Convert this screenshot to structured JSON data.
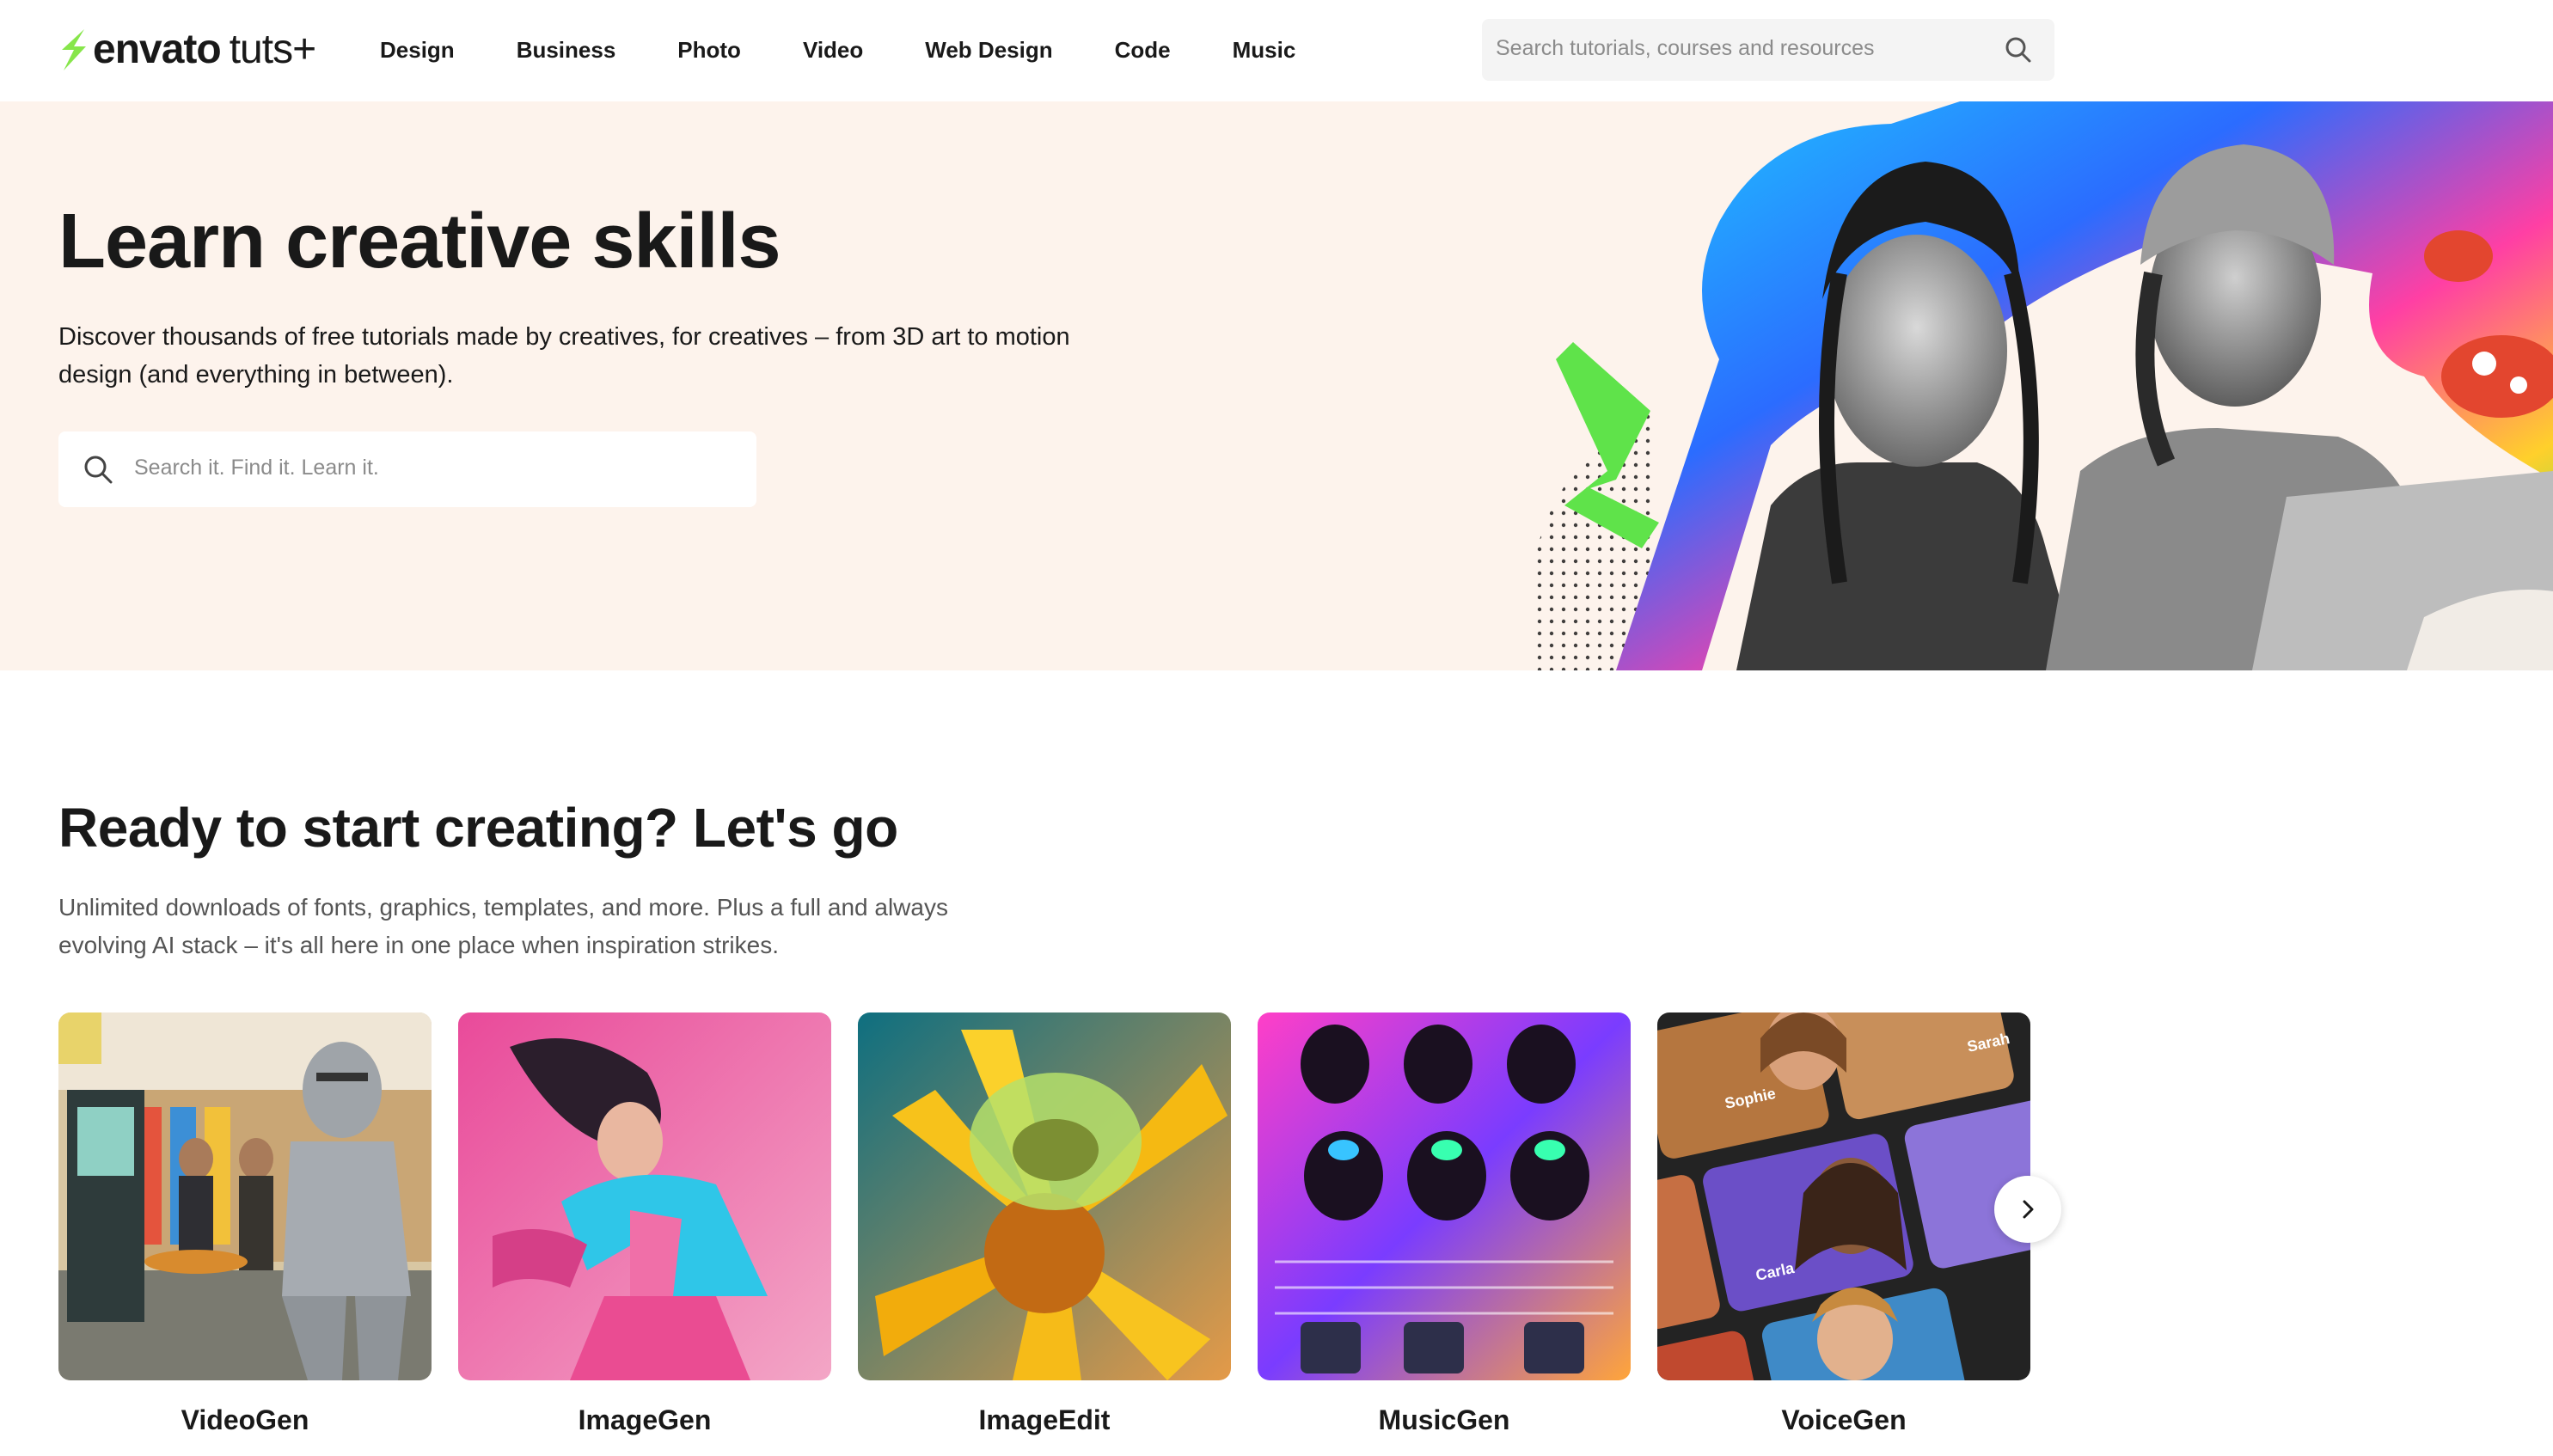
{
  "brand": {
    "name": "envato",
    "product": "tuts+",
    "accent": "#87e64b"
  },
  "nav": {
    "items": [
      "Design",
      "Business",
      "Photo",
      "Video",
      "Web Design",
      "Code",
      "Music"
    ]
  },
  "header_search": {
    "placeholder": "Search tutorials, courses and resources",
    "icon": "search-icon"
  },
  "hero": {
    "title": "Learn creative skills",
    "description": "Discover thousands of free tutorials made by creatives, for creatives – from 3D art to motion design (and everything in between).",
    "search_placeholder": "Search it. Find it. Learn it.",
    "background": "#fdf3ec"
  },
  "section": {
    "title": "Ready to start creating? Let's go",
    "description": "Unlimited downloads of fonts, graphics, templates, and more. Plus a full and always evolving AI stack – it's all here in one place when inspiration strikes."
  },
  "cards": [
    {
      "label": "VideoGen",
      "image": "knight-at-self-checkout"
    },
    {
      "label": "ImageGen",
      "image": "dancer-in-neon"
    },
    {
      "label": "ImageEdit",
      "image": "bee-on-yellow-flower"
    },
    {
      "label": "MusicGen",
      "image": "mixing-console-knobs"
    },
    {
      "label": "VoiceGen",
      "image": "character-avatars",
      "name_tags": [
        "Sophie",
        "Sarah",
        "Carla"
      ]
    }
  ],
  "carousel": {
    "next_icon": "chevron-right-icon"
  }
}
